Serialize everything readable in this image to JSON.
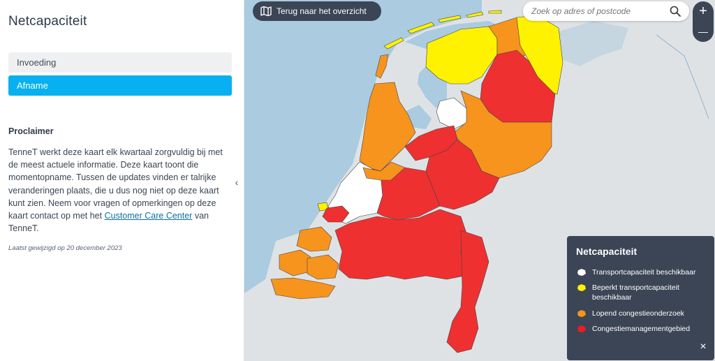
{
  "sidebar": {
    "title": "Netcapaciteit",
    "tabs": [
      {
        "label": "Invoeding"
      },
      {
        "label": "Afname"
      }
    ],
    "proclaimer_title": "Proclaimer",
    "proclaimer_text": "TenneT werkt deze kaart elk kwartaal zorgvuldig bij met de meest actuele informatie. Deze kaart toont die momentopname. Tussen de updates vinden er talrijke veranderingen plaats, die u dus nog niet op deze kaart kunt zien. Neem voor vragen of opmerkingen op deze kaart contact op met het",
    "link_text": "Customer Care Center",
    "link_suffix": "van TenneT.",
    "updated": "Laatst gewijzigd op 20 december 2023"
  },
  "map": {
    "back_label": "Terug naar het overzicht",
    "search_placeholder": "Zoek op adres of postcode",
    "zoom_in": "+",
    "zoom_out": "—"
  },
  "legend": {
    "title": "Netcapaciteit",
    "items": [
      {
        "label": "Transportcapaciteit beschikbaar",
        "color": "#ffffff"
      },
      {
        "label": "Beperkt transportcapaciteit beschikbaar",
        "color": "#fff200"
      },
      {
        "label": "Lopend congestieonderzoek",
        "color": "#f7941d"
      },
      {
        "label": "Congestiemanagementgebied",
        "color": "#ee1c25"
      }
    ],
    "close": "×"
  },
  "colors": {
    "available": "#ffffff",
    "limited": "#ffff00",
    "investigation": "#f7941d",
    "congestion": "#ef3030",
    "water": "#aacbe0",
    "land": "#dfe2e5",
    "accent": "#07b0f0"
  }
}
